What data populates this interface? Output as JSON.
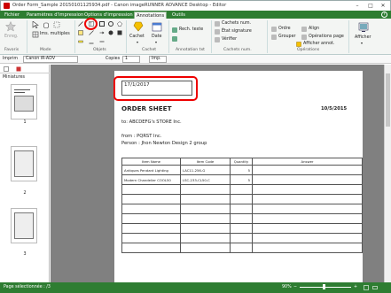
{
  "window": {
    "title": "Order Form_Sample 20150101125934.pdf - Canon imageRUNNER ADVANCE Desktop - Editor"
  },
  "tabs": [
    "Fichier",
    "Paramètres d'impression",
    "Options d'impression",
    "Annotations",
    "Outils"
  ],
  "active_tab": "Annotations",
  "ribbon": {
    "groups": {
      "favoris": "Favoris",
      "mode": "Mode",
      "objets": "Objets",
      "cachet": "Cachet",
      "annotation_txt": "Annotation txt",
      "cachets_num": "Cachets num.",
      "operations": "Opérations"
    },
    "enreg": "Enreg.",
    "ims_multiples": "Ims. multiples",
    "cachet_btn": "Cachet",
    "date_btn": "Date",
    "rech_texte": "Rech. texte",
    "cachets_num_btn": "Cachets num.",
    "etat_signature": "État signature",
    "verifier": "Vérifier",
    "ordre": "Ordre",
    "grouper": "Grouper",
    "aligner": "Align",
    "operations_page": "Opérations page",
    "afficher_annot": "Afficher annot.",
    "afficher": "Afficher"
  },
  "toolbar": {
    "imprimer_label": "Imprim",
    "printer": "Canon iR-ADV",
    "copies_label": "Copies",
    "copies_value": "1",
    "mode_value": "Imp."
  },
  "left_panel": {
    "title": "Miniatures",
    "thumbs": [
      "1",
      "2",
      "3"
    ]
  },
  "document": {
    "date_field": "17/1/2017",
    "heading": "ORDER SHEET",
    "date_right": "10/5/2015",
    "to": "to: ABCDEFG's STORE Inc.",
    "from": "from : PQRST Inc.",
    "person": "Person : Jhon Newton   Design 2 group",
    "table": {
      "headers": [
        "Item Name",
        "Item Code",
        "Quantity",
        "Answer"
      ],
      "rows": [
        [
          "Antiques Pendant Lighting",
          "LAC11-256-G",
          "5",
          ""
        ],
        [
          "Modern Chandelier COOL50",
          "LSC-233-CL50-C",
          "5",
          ""
        ],
        [
          "",
          "",
          "",
          ""
        ],
        [
          "",
          "",
          "",
          ""
        ],
        [
          "",
          "",
          "",
          ""
        ],
        [
          "",
          "",
          "",
          ""
        ],
        [
          "",
          "",
          "",
          ""
        ],
        [
          "",
          "",
          "",
          ""
        ],
        [
          "",
          "",
          "",
          ""
        ]
      ]
    }
  },
  "statusbar": {
    "page_info": "Page sélectionnée : /3",
    "zoom": "90%"
  },
  "colors": {
    "accent": "#2e7d32",
    "highlight": "#e00000",
    "doc_background": "#808080"
  }
}
